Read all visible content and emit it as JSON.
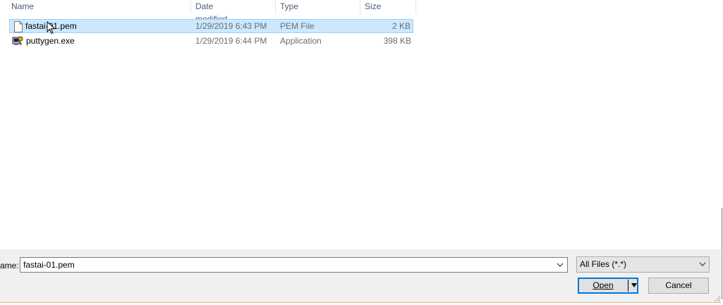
{
  "columns": {
    "name": "Name",
    "date": "Date modified",
    "type": "Type",
    "size": "Size"
  },
  "files": [
    {
      "name": "fastai-01.pem",
      "date": "1/29/2019 6:43 PM",
      "type": "PEM File",
      "size": "2 KB",
      "icon": "document-icon",
      "selected": true
    },
    {
      "name": "puttygen.exe",
      "date": "1/29/2019 6:44 PM",
      "type": "Application",
      "size": "398 KB",
      "icon": "puttygen-app-icon",
      "selected": false
    }
  ],
  "footer": {
    "filename_label": "ame:",
    "filename_value": "fastai-01.pem",
    "filter_value": "All Files (*.*)",
    "open_label": "Open",
    "cancel_label": "Cancel"
  },
  "colors": {
    "selection_bg": "#cce8ff",
    "selection_border": "#99d1ff",
    "header_text": "#4c607a",
    "accent": "#0078d7"
  }
}
